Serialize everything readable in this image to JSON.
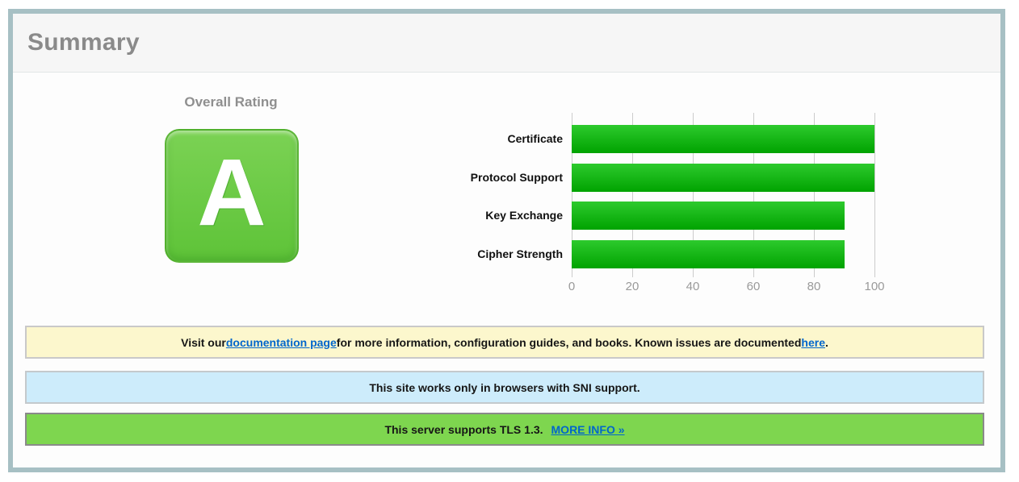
{
  "header": {
    "title": "Summary"
  },
  "overall_rating": {
    "label": "Overall Rating",
    "grade": "A",
    "badge_gradient_top": "#7bd254",
    "badge_gradient_bottom": "#5ec338"
  },
  "chart_data": {
    "type": "bar",
    "orientation": "horizontal",
    "categories": [
      "Certificate",
      "Protocol Support",
      "Key Exchange",
      "Cipher Strength"
    ],
    "values": [
      100,
      100,
      90,
      90
    ],
    "xlim": [
      0,
      100
    ],
    "xticks": [
      0,
      20,
      40,
      60,
      80,
      100
    ],
    "grid": true,
    "legend": false,
    "bar_gradient_top": "#2dca2d",
    "bar_gradient_bottom": "#00a300"
  },
  "notices": {
    "documentation": {
      "background": "#fcf7cd",
      "pre": "Visit our ",
      "link1": "documentation page",
      "mid": " for more information, configuration guides, and books. Known issues are documented ",
      "link2": "here",
      "post": "."
    },
    "sni": {
      "background": "#cdecfb",
      "text": "This site works only in browsers with SNI support."
    },
    "tls": {
      "background": "#7ed64f",
      "text": "This server supports TLS 1.3.",
      "link": "MORE INFO »"
    }
  },
  "colors": {
    "frame_border": "#a7c0c4",
    "link_blue": "#0066cc",
    "grade_green": "#65c73e",
    "bar_green": "#1bbb1b",
    "gridline_gray": "#cccccc"
  }
}
